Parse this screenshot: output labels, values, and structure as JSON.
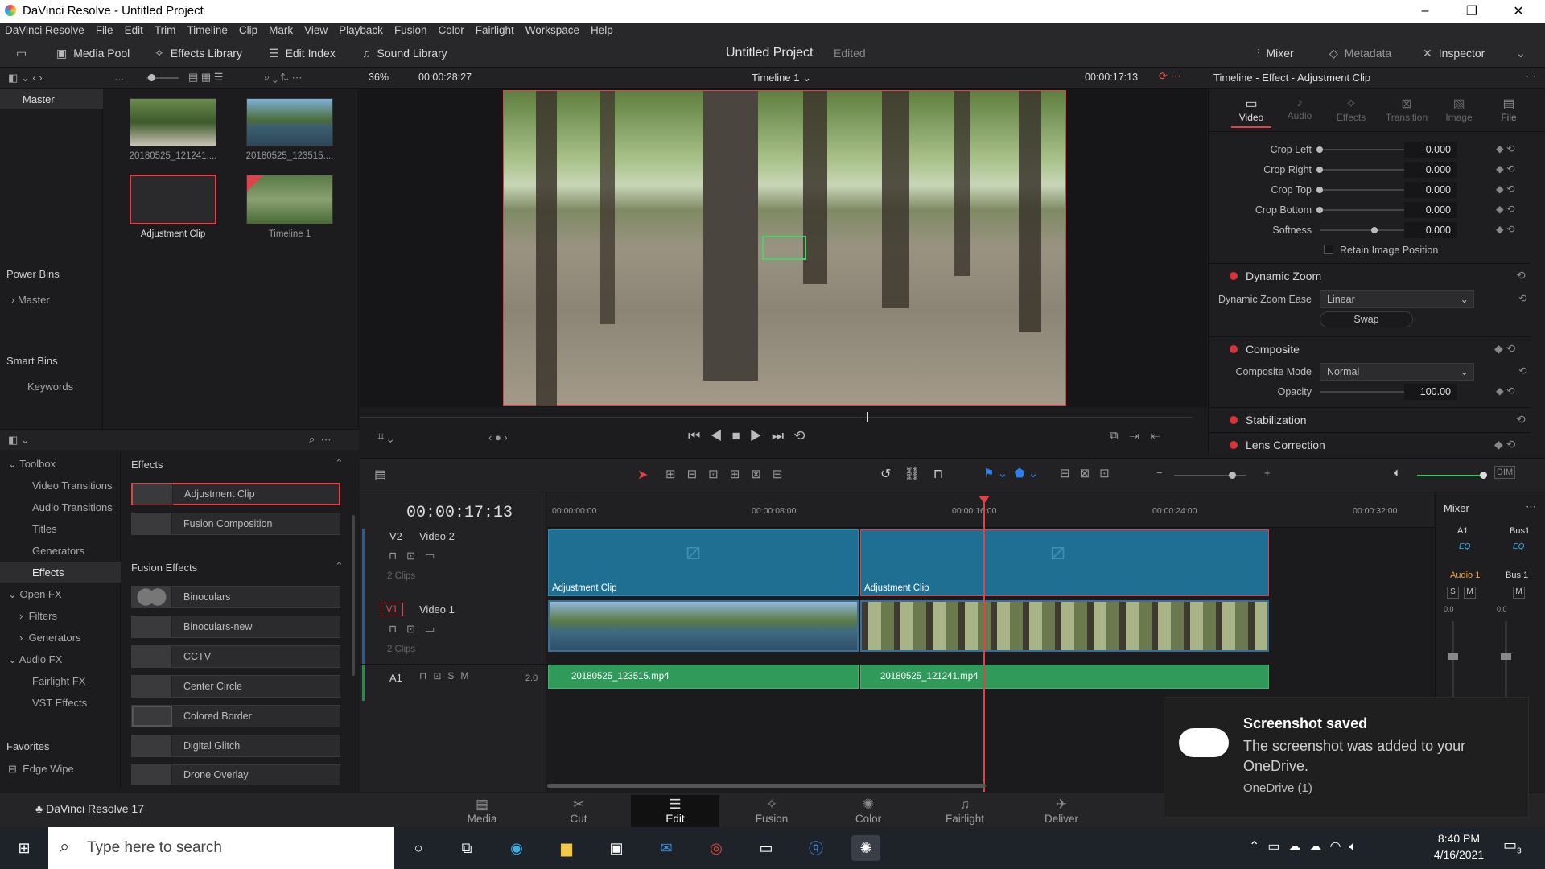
{
  "window": {
    "title": "DaVinci Resolve - Untitled Project",
    "controls": [
      "–",
      "❐",
      "✕"
    ]
  },
  "menu": [
    "DaVinci Resolve",
    "File",
    "Edit",
    "Trim",
    "Timeline",
    "Clip",
    "Mark",
    "View",
    "Playback",
    "Fusion",
    "Color",
    "Fairlight",
    "Workspace",
    "Help"
  ],
  "toolbar": {
    "media_pool": "Media Pool",
    "effects_library": "Effects Library",
    "edit_index": "Edit Index",
    "sound_library": "Sound Library",
    "project_title": "Untitled Project",
    "edited": "Edited",
    "mixer": "Mixer",
    "metadata": "Metadata",
    "inspector": "Inspector"
  },
  "viewer": {
    "zoom": "36%",
    "duration": "00:00:28:27",
    "timeline_name": "Timeline 1",
    "timecode": "00:00:17:13",
    "inspector_header": "Timeline - Effect - Adjustment Clip"
  },
  "bins": {
    "master": "Master",
    "power_bins": "Power Bins",
    "power_master": "Master",
    "smart_bins": "Smart Bins",
    "keywords": "Keywords"
  },
  "media": [
    {
      "name": "20180525_121241...."
    },
    {
      "name": "20180525_123515...."
    },
    {
      "name": "Adjustment Clip"
    },
    {
      "name": "Timeline 1"
    }
  ],
  "fx_tree": {
    "toolbox": "Toolbox",
    "video_transitions": "Video Transitions",
    "audio_transitions": "Audio Transitions",
    "titles": "Titles",
    "generators": "Generators",
    "effects": "Effects",
    "open_fx": "Open FX",
    "filters": "Filters",
    "generators2": "Generators",
    "audio_fx": "Audio FX",
    "fairlight_fx": "Fairlight FX",
    "vst_effects": "VST Effects",
    "favorites": "Favorites",
    "edge_wipe": "Edge Wipe"
  },
  "fx_list": {
    "effects_header": "Effects",
    "adjustment_clip": "Adjustment Clip",
    "fusion_composition": "Fusion Composition",
    "fusion_effects_header": "Fusion Effects",
    "items": [
      "Binoculars",
      "Binoculars-new",
      "CCTV",
      "Center Circle",
      "Colored Border",
      "Digital Glitch",
      "Drone Overlay"
    ]
  },
  "inspector": {
    "tabs": [
      "Video",
      "Audio",
      "Effects",
      "Transition",
      "Image",
      "File"
    ],
    "crop": [
      {
        "label": "Crop Left",
        "value": "0.000"
      },
      {
        "label": "Crop Right",
        "value": "0.000"
      },
      {
        "label": "Crop Top",
        "value": "0.000"
      },
      {
        "label": "Crop Bottom",
        "value": "0.000"
      },
      {
        "label": "Softness",
        "value": "0.000"
      }
    ],
    "retain": "Retain Image Position",
    "dynamic_zoom": "Dynamic Zoom",
    "dz_ease_label": "Dynamic Zoom Ease",
    "dz_ease": "Linear",
    "swap": "Swap",
    "composite": "Composite",
    "comp_mode_label": "Composite Mode",
    "comp_mode": "Normal",
    "opacity_label": "Opacity",
    "opacity": "100.00",
    "stabilization": "Stabilization",
    "lens_correction": "Lens Correction"
  },
  "timeline": {
    "timecode": "00:00:17:13",
    "ruler": [
      "00:00:00:00",
      "00:00:08:00",
      "00:00:16:00",
      "00:00:24:00",
      "00:00:32:00"
    ],
    "v2": "V2",
    "v2_name": "Video 2",
    "v2_clips": "2 Clips",
    "v1": "V1",
    "v1_name": "Video 1",
    "v1_clips": "2 Clips",
    "a1": "A1",
    "a1_level": "2.0",
    "adj1": "Adjustment Clip",
    "adj2": "Adjustment Clip",
    "audio1": "20180525_123515.mp4",
    "audio2": "20180525_121241.mp4"
  },
  "mixer": {
    "title": "Mixer",
    "a1": "A1",
    "bus1": "Bus1",
    "eq": "EQ",
    "audio1": "Audio 1",
    "bus1b": "Bus 1",
    "s": "S",
    "m": "M",
    "db1": "0.0",
    "db2": "0.0"
  },
  "pages": [
    "Media",
    "Cut",
    "Edit",
    "Fusion",
    "Color",
    "Fairlight",
    "Deliver"
  ],
  "app_version": "DaVinci Resolve 17",
  "toast": {
    "title": "Screenshot saved",
    "body": "The screenshot was added to your OneDrive.",
    "source": "OneDrive (1)"
  },
  "taskbar": {
    "search": "Type here to search",
    "time": "8:40 PM",
    "date": "4/16/2021",
    "notif": "3"
  }
}
